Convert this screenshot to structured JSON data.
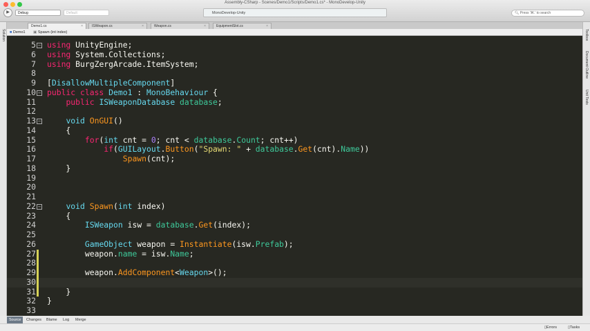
{
  "window": {
    "title": "Assembly-CSharp - Scenes/Demo1/Scripts/Demo1.cs* - MonoDevelop-Unity"
  },
  "toolbar": {
    "run_icon": "play-icon",
    "config": "Debug",
    "platform": "Default",
    "status": "MonoDevelop-Unity",
    "search_placeholder": "Press '⌘.' to search"
  },
  "tabs": [
    {
      "label": "Demo1.cs",
      "active": true
    },
    {
      "label": "ISWeapon.cs"
    },
    {
      "label": "Weapon.cs"
    },
    {
      "label": "EquipmentSlot.cs"
    }
  ],
  "breadcrumb": {
    "class": "Demo1",
    "method": "Spawn (int index)"
  },
  "left_pad": {
    "solution": "Solution"
  },
  "right_pad": {
    "toolbox": "Toolbox",
    "outline": "Document Outline",
    "tests": "Unit Tests"
  },
  "code": [
    {
      "n": "5",
      "fold": "−",
      "t": [
        [
          "using",
          "kw"
        ],
        [
          " UnityEngine;",
          ""
        ]
      ]
    },
    {
      "n": "6",
      "t": [
        [
          "using",
          "kw"
        ],
        [
          " System.Collections;",
          ""
        ]
      ]
    },
    {
      "n": "7",
      "t": [
        [
          "using",
          "kw"
        ],
        [
          " BurgZergArcade.ItemSystem;",
          ""
        ]
      ]
    },
    {
      "n": "8",
      "t": []
    },
    {
      "n": "9",
      "t": [
        [
          "[",
          ""
        ],
        [
          "DisallowMultipleComponent",
          "ty"
        ],
        [
          "]",
          ""
        ]
      ]
    },
    {
      "n": "10",
      "fold": "−",
      "t": [
        [
          "public class",
          "kw"
        ],
        [
          " ",
          ""
        ],
        [
          "Demo1",
          "ty"
        ],
        [
          " : ",
          ""
        ],
        [
          "MonoBehaviour",
          "ty"
        ],
        [
          " {",
          ""
        ]
      ]
    },
    {
      "n": "11",
      "t": [
        [
          "    ",
          ""
        ],
        [
          "public",
          "kw"
        ],
        [
          " ",
          ""
        ],
        [
          "ISWeaponDatabase",
          "ty"
        ],
        [
          " ",
          ""
        ],
        [
          "database",
          "mb"
        ],
        [
          ";",
          ""
        ]
      ]
    },
    {
      "n": "12",
      "t": []
    },
    {
      "n": "13",
      "fold": "−",
      "t": [
        [
          "    ",
          ""
        ],
        [
          "void",
          "ty"
        ],
        [
          " ",
          ""
        ],
        [
          "OnGUI",
          "fn"
        ],
        [
          "()",
          ""
        ]
      ]
    },
    {
      "n": "14",
      "t": [
        [
          "    {",
          ""
        ]
      ]
    },
    {
      "n": "15",
      "t": [
        [
          "        ",
          ""
        ],
        [
          "for",
          "kw"
        ],
        [
          "(",
          ""
        ],
        [
          "int",
          "ty"
        ],
        [
          " cnt = ",
          ""
        ],
        [
          "0",
          "nu"
        ],
        [
          "; cnt < ",
          ""
        ],
        [
          "database",
          "mb"
        ],
        [
          ".",
          ""
        ],
        [
          "Count",
          "mb"
        ],
        [
          "; cnt++)",
          ""
        ]
      ]
    },
    {
      "n": "16",
      "t": [
        [
          "            ",
          ""
        ],
        [
          "if",
          "kw"
        ],
        [
          "(",
          ""
        ],
        [
          "GUILayout",
          "ty"
        ],
        [
          ".",
          ""
        ],
        [
          "Button",
          "fn"
        ],
        [
          "(",
          ""
        ],
        [
          "\"Spawn: \"",
          "st"
        ],
        [
          " + ",
          ""
        ],
        [
          "database",
          "mb"
        ],
        [
          ".",
          ""
        ],
        [
          "Get",
          "fn"
        ],
        [
          "(cnt).",
          ""
        ],
        [
          "Name",
          "mb"
        ],
        [
          "))",
          ""
        ]
      ]
    },
    {
      "n": "17",
      "t": [
        [
          "                ",
          ""
        ],
        [
          "Spawn",
          "fn"
        ],
        [
          "(cnt);",
          ""
        ]
      ]
    },
    {
      "n": "18",
      "t": [
        [
          "    }",
          ""
        ]
      ]
    },
    {
      "n": "19",
      "t": []
    },
    {
      "n": "20",
      "t": []
    },
    {
      "n": "21",
      "t": []
    },
    {
      "n": "22",
      "fold": "−",
      "t": [
        [
          "    ",
          ""
        ],
        [
          "void",
          "ty"
        ],
        [
          " ",
          ""
        ],
        [
          "Spawn",
          "fn"
        ],
        [
          "(",
          ""
        ],
        [
          "int",
          "ty"
        ],
        [
          " index)",
          ""
        ]
      ]
    },
    {
      "n": "23",
      "t": [
        [
          "    {",
          ""
        ]
      ]
    },
    {
      "n": "24",
      "t": [
        [
          "        ",
          ""
        ],
        [
          "ISWeapon",
          "ty"
        ],
        [
          " isw = ",
          ""
        ],
        [
          "database",
          "mb"
        ],
        [
          ".",
          ""
        ],
        [
          "Get",
          "fn"
        ],
        [
          "(index);",
          ""
        ]
      ]
    },
    {
      "n": "25",
      "t": []
    },
    {
      "n": "26",
      "t": [
        [
          "        ",
          ""
        ],
        [
          "GameObject",
          "ty"
        ],
        [
          " weapon = ",
          ""
        ],
        [
          "Instantiate",
          "fn"
        ],
        [
          "(isw.",
          ""
        ],
        [
          "Prefab",
          "mb"
        ],
        [
          ");",
          ""
        ]
      ]
    },
    {
      "n": "27",
      "mod": true,
      "t": [
        [
          "        weapon.",
          ""
        ],
        [
          "name",
          "mb"
        ],
        [
          " = isw.",
          ""
        ],
        [
          "Name",
          "mb"
        ],
        [
          ";",
          ""
        ]
      ]
    },
    {
      "n": "28",
      "mod": true,
      "t": []
    },
    {
      "n": "29",
      "mod": true,
      "t": [
        [
          "        weapon.",
          ""
        ],
        [
          "AddComponent",
          "fn"
        ],
        [
          "<",
          ""
        ],
        [
          "Weapon",
          "ty"
        ],
        [
          ">();",
          ""
        ]
      ]
    },
    {
      "n": "30",
      "mod": true,
      "cur": true,
      "t": []
    },
    {
      "n": "31",
      "mod": true,
      "t": [
        [
          "    }",
          ""
        ]
      ]
    },
    {
      "n": "32",
      "t": [
        [
          "}",
          ""
        ]
      ]
    },
    {
      "n": "33",
      "t": []
    }
  ],
  "bottom_tabs": [
    {
      "label": "Source",
      "active": true
    },
    {
      "label": "Changes"
    },
    {
      "label": "Blame"
    },
    {
      "label": "Log"
    },
    {
      "label": "Merge"
    }
  ],
  "status": {
    "errors": "Errors",
    "tasks": "Tasks"
  }
}
